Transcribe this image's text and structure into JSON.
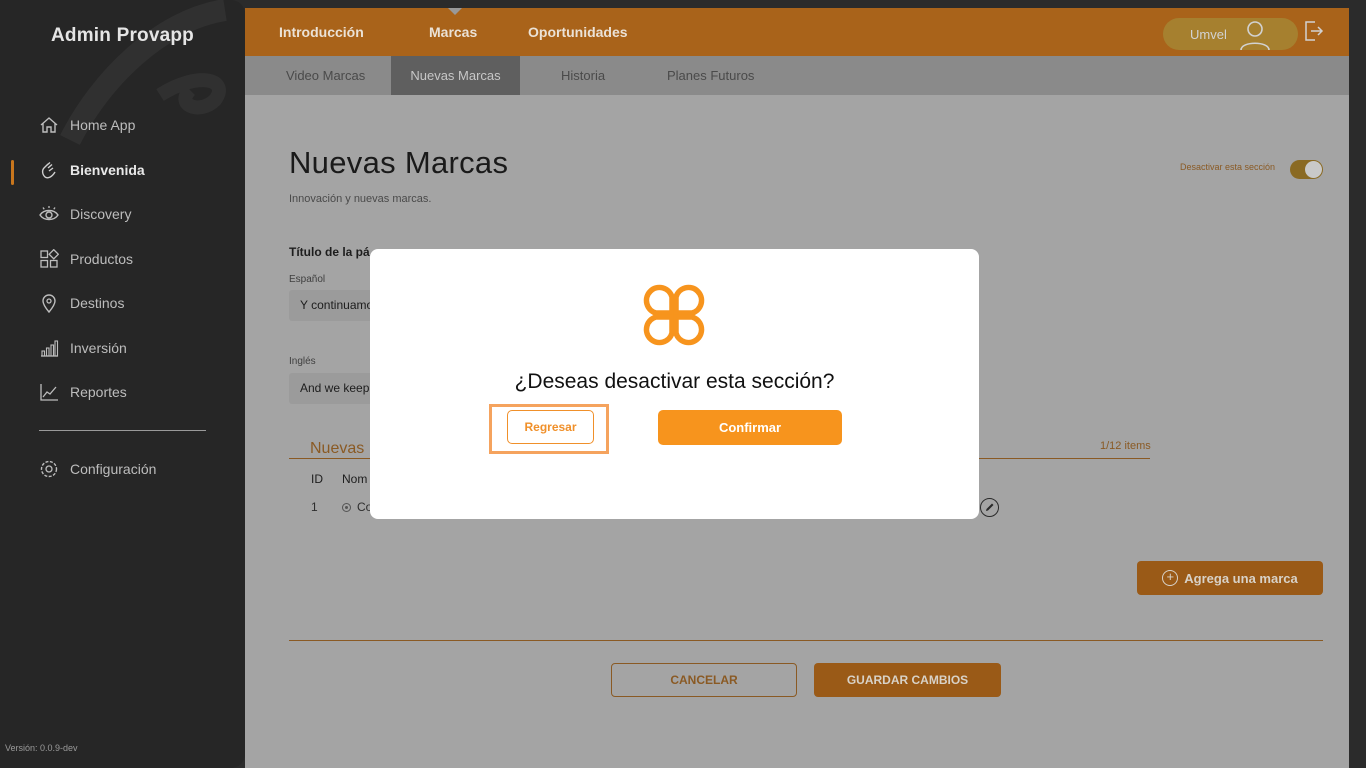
{
  "app": {
    "title": "Admin Provapp",
    "version": "Versión: 0.0.9-dev"
  },
  "sidebar": {
    "items": [
      {
        "label": "Home App",
        "icon": "home-icon"
      },
      {
        "label": "Bienvenida",
        "icon": "waving-hand-icon",
        "active": true
      },
      {
        "label": "Discovery",
        "icon": "eye-icon"
      },
      {
        "label": "Productos",
        "icon": "grid-icon"
      },
      {
        "label": "Destinos",
        "icon": "location-pin-icon"
      },
      {
        "label": "Inversión",
        "icon": "bar-chart-icon"
      },
      {
        "label": "Reportes",
        "icon": "line-chart-icon"
      },
      {
        "label": "Configuración",
        "icon": "gear-icon"
      }
    ]
  },
  "topnav": {
    "tabs": [
      "Introducción",
      "Marcas",
      "Oportunidades"
    ],
    "active": "Marcas",
    "user": "Umvel"
  },
  "subnav": {
    "tabs": [
      "Video Marcas",
      "Nuevas Marcas",
      "Historia",
      "Planes Futuros"
    ],
    "active": "Nuevas Marcas"
  },
  "page": {
    "title": "Nuevas Marcas",
    "subtitle": "Innovación y nuevas marcas.",
    "toggle_label": "Desactivar esta sección",
    "field_heading": "Título de la pá",
    "spanish_label": "Español",
    "spanish_value": "Y continuamo",
    "english_label": "Inglés",
    "english_value": "And we keep",
    "section_title": "Nuevas",
    "items_count": "1/12 items",
    "table": {
      "headers": [
        "ID",
        "Nom"
      ],
      "rows": [
        {
          "id": "1",
          "name": "Co"
        }
      ]
    },
    "add_brand": "Agrega una marca",
    "cancel": "CANCELAR",
    "save": "GUARDAR CAMBIOS"
  },
  "modal": {
    "question": "¿Deseas desactivar esta sección?",
    "back": "Regresar",
    "confirm": "Confirmar"
  },
  "colors": {
    "accent": "#f7941d",
    "sidebar_bg": "#262626",
    "overlay_content": "#a4a4a4"
  }
}
